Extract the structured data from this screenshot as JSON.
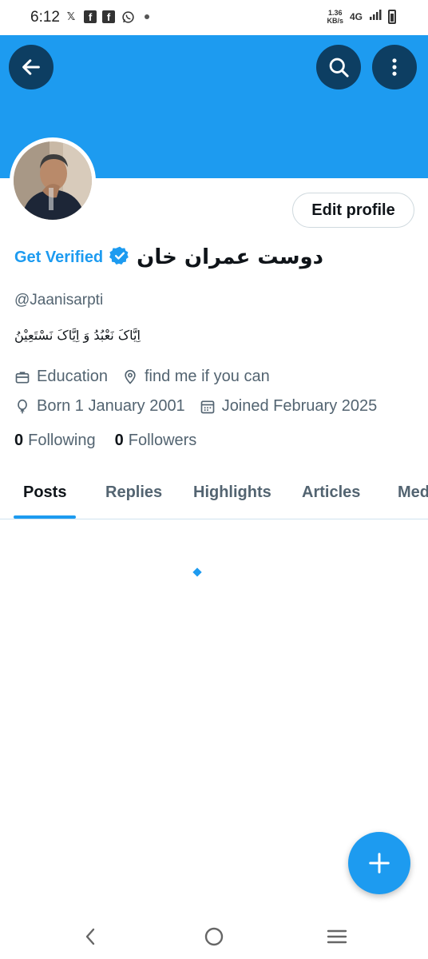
{
  "status_bar": {
    "time": "6:12",
    "icons": [
      "x-icon",
      "facebook-icon",
      "facebook-icon",
      "whatsapp-icon",
      "dot-icon"
    ],
    "net_speed_value": "1.36",
    "net_speed_unit": "KB/s",
    "network": "4G"
  },
  "header": {
    "banner_color": "#1d9bf0",
    "button_color": "#0d3e62"
  },
  "profile": {
    "edit_label": "Edit profile",
    "get_verified": "Get Verified",
    "display_name": "دوست عمران خان",
    "handle": "@Jaanisarpti",
    "bio": "اِیَّاکَ نَعْبُدُ وَ اِیَّاکَ نَسْتَعِیْنُ",
    "category": "Education",
    "location": "find me if you can",
    "born": "Born 1 January 2001",
    "joined": "Joined February 2025",
    "following_count": "0",
    "following_label": "Following",
    "followers_count": "0",
    "followers_label": "Followers"
  },
  "tabs": [
    {
      "label": "Posts",
      "active": true
    },
    {
      "label": "Replies",
      "active": false
    },
    {
      "label": "Highlights",
      "active": false
    },
    {
      "label": "Articles",
      "active": false
    },
    {
      "label": "Media",
      "active": false
    }
  ],
  "colors": {
    "accent": "#1d9bf0",
    "text_primary": "#0f1419",
    "text_secondary": "#536471"
  }
}
